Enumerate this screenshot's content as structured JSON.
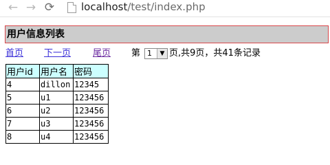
{
  "browser": {
    "back_icon": "←",
    "forward_icon": "→",
    "reload_icon": "⟳",
    "address_host": "localhost",
    "address_path": "/test/index.php"
  },
  "page": {
    "title": "用户信息列表",
    "pager": {
      "first_label": "首页",
      "next_label": "下一页",
      "last_label": "尾页",
      "prefix": "第",
      "current_page": "1",
      "suffix": "页,共9页，共41条记录"
    },
    "table": {
      "headers": [
        "用户id",
        "用户名",
        "密码"
      ],
      "rows": [
        [
          "4",
          "dillon",
          "12345"
        ],
        [
          "5",
          "u1",
          "123456"
        ],
        [
          "6",
          "u2",
          "123456"
        ],
        [
          "7",
          "u3",
          "123456"
        ],
        [
          "8",
          "u4",
          "123456"
        ]
      ]
    }
  }
}
